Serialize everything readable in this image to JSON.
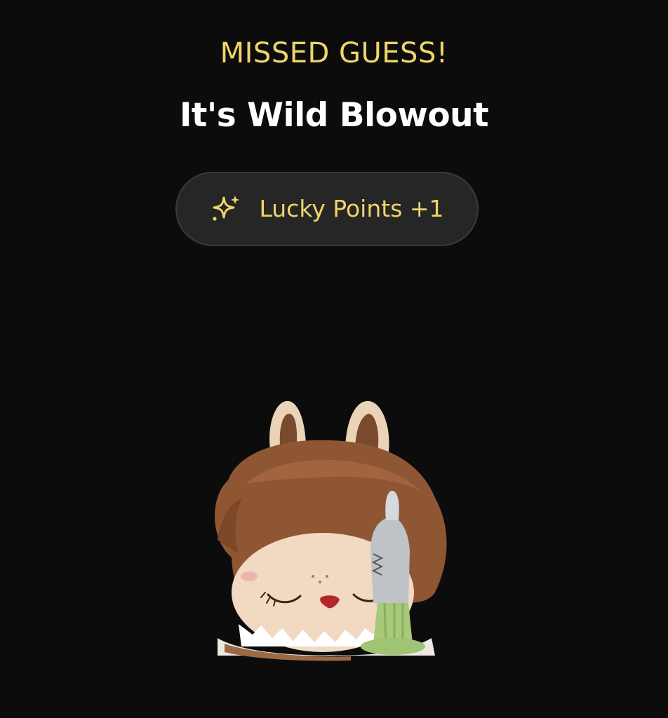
{
  "result": {
    "heading": "MISSED GUESS!",
    "title": "It's Wild Blowout"
  },
  "reward": {
    "label": "Lucky Points +1",
    "icon": "sparkle-icon",
    "accent_color": "#f0d46a"
  },
  "colors": {
    "background": "#0c0c0d",
    "pill_background": "#262626",
    "title": "#ffffff"
  }
}
